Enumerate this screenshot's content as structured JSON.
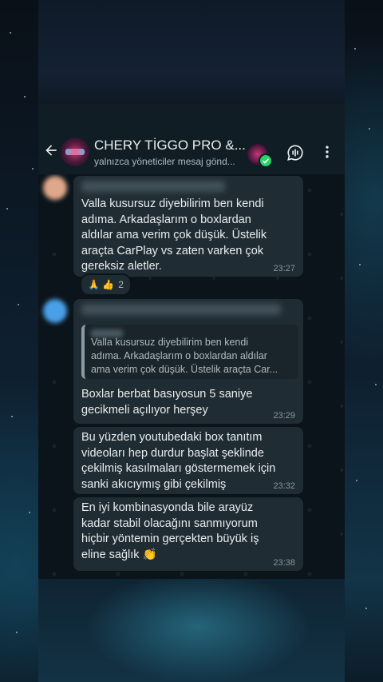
{
  "header": {
    "group_title": "CHERY TİGGO PRO &...",
    "group_subtitle": "yalnızca yöneticiler mesaj gönd..."
  },
  "messages": [
    {
      "text_lines": [
        "Valla kusursuz diyebilirim ben kendi",
        "adıma. Arkadaşlarım o boxlardan",
        "aldılar ama verim çok düşük. Üstelik",
        "araçta CarPlay vs zaten varken çok",
        "gereksiz aletler."
      ],
      "time": "23:27",
      "reactions": {
        "emojis": "🙏 👍",
        "count": "2"
      }
    },
    {
      "quote_lines": [
        "Valla kusursuz diyebilirim ben kendi",
        "adıma. Arkadaşlarım o boxlardan aldılar",
        "ama verim çok düşük. Üstelik araçta Car..."
      ],
      "text_lines": [
        "Boxlar berbat basıyosun 5 saniye",
        "gecikmeli açılıyor herşey"
      ],
      "time": "23:29"
    },
    {
      "text_lines": [
        "Bu yüzden youtubedaki box tanıtım",
        "videoları hep durdur başlat şeklinde",
        "çekilmiş kasılmaları göstermemek için",
        "sanki akıcıymış gibi çekilmiş"
      ],
      "time": "23:32"
    },
    {
      "text_lines": [
        "En iyi kombinasyonda bile arayüz",
        "kadar stabil olacağını sanmıyorum",
        "hiçbir yöntemin gerçekten büyük iş",
        "eline sağlık 👏"
      ],
      "time": "23:38"
    }
  ],
  "colors": {
    "bubble": "#202c33",
    "chat_bg": "#0b141a",
    "header_bg": "#101d25",
    "accent": "#25d366"
  },
  "icons": [
    "back-arrow-icon",
    "voice-chat-icon",
    "more-vertical-icon",
    "verified-check-icon"
  ]
}
